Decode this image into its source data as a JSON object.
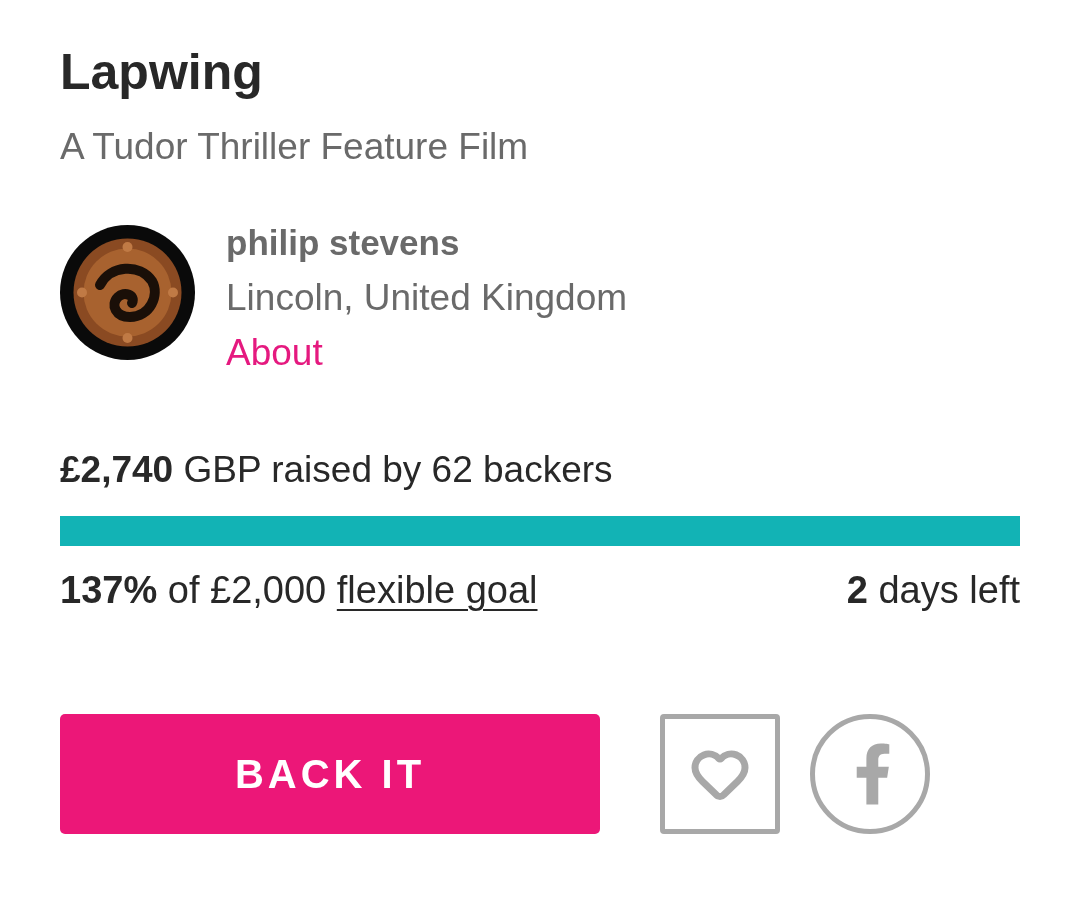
{
  "project": {
    "title": "Lapwing",
    "subtitle": "A Tudor Thriller Feature Film"
  },
  "creator": {
    "name": "philip stevens",
    "location": "Lincoln, United Kingdom",
    "about_link": "About"
  },
  "funding": {
    "raised": "**£2,740** GBP raised by 62 backers",
    "progress": {
      "level": 1
    },
    "goal": "**137%** of £2,000",
    "goal_link": "flexible goal",
    "time_left": "**2** days left"
  },
  "actions": {
    "back_button": "BACK IT"
  }
}
